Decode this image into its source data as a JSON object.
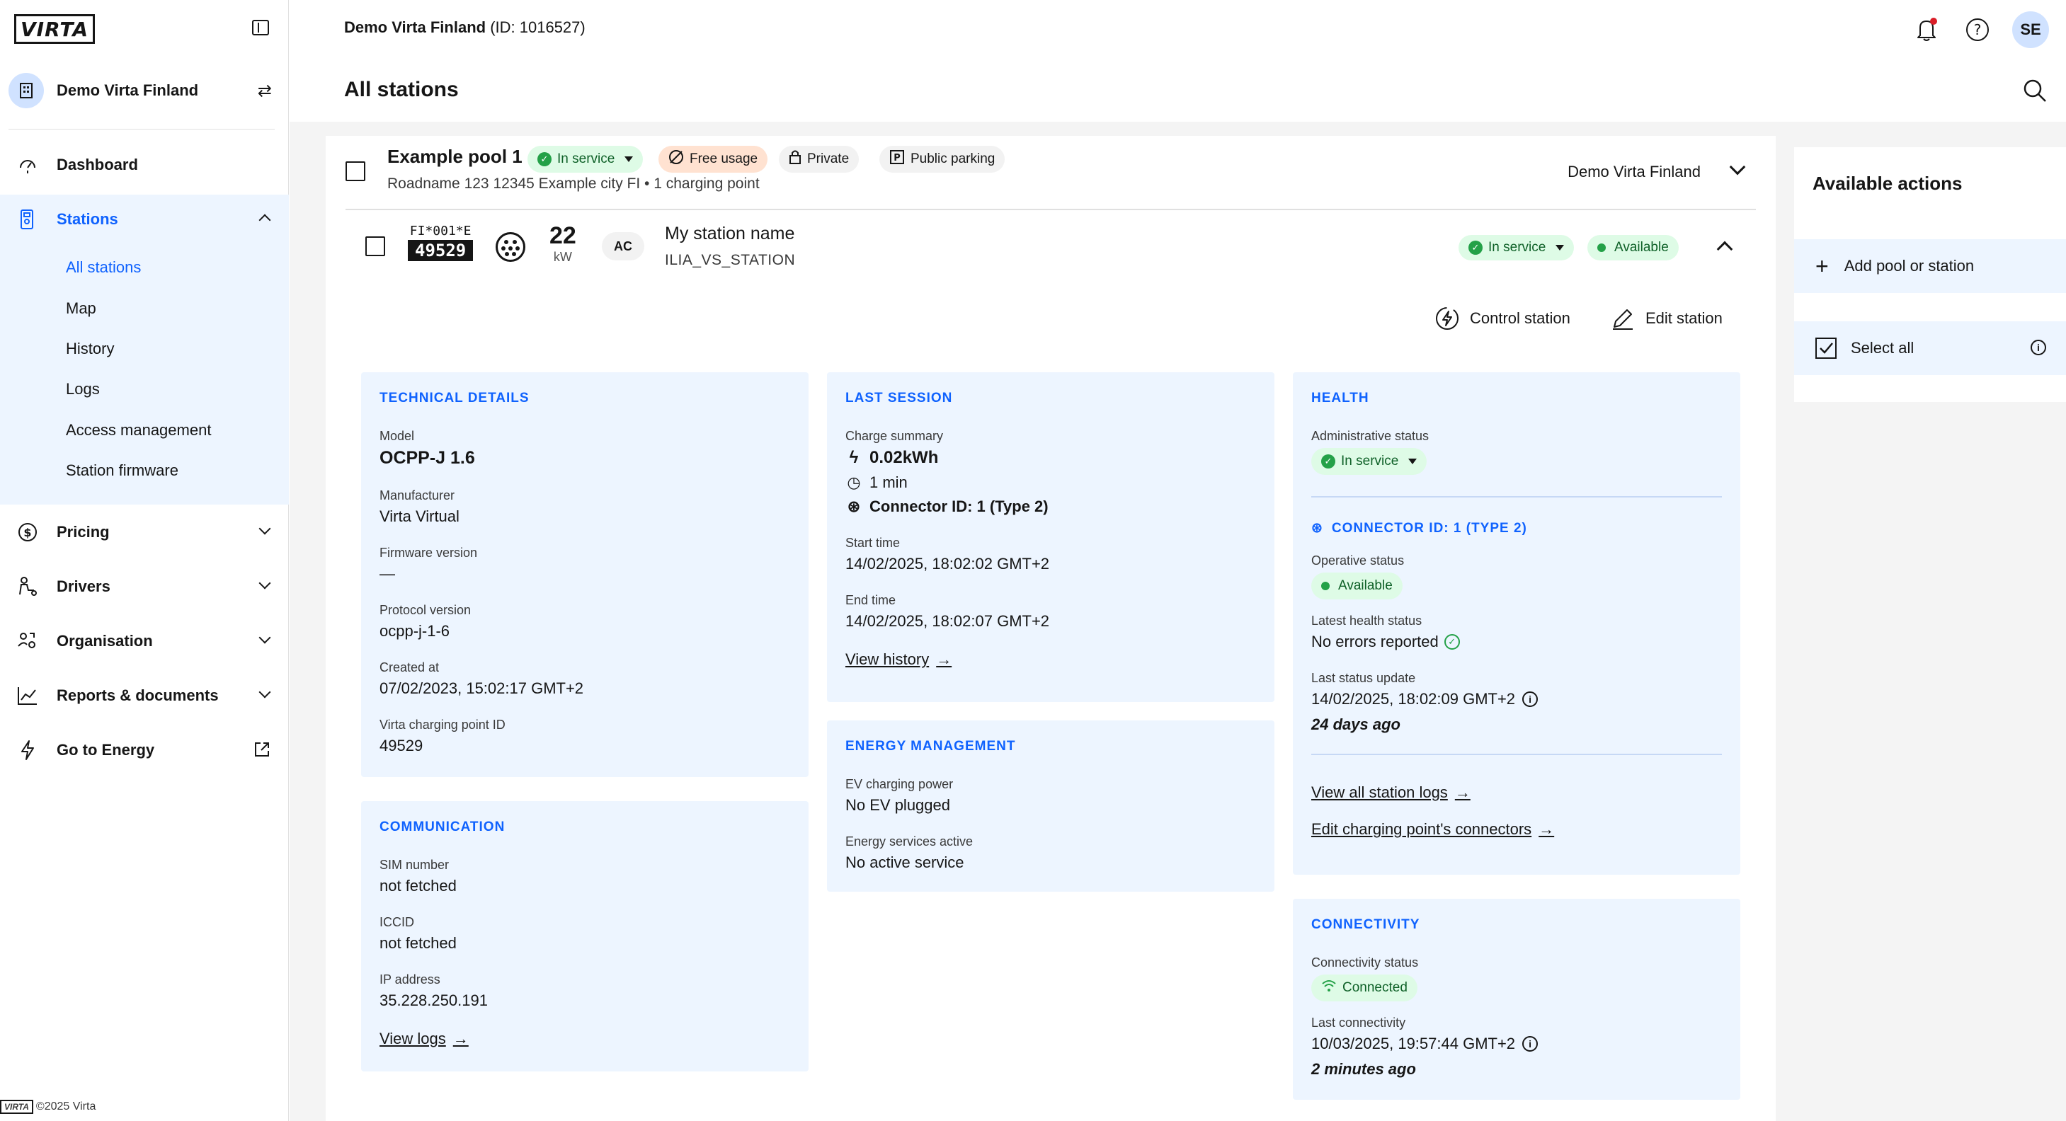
{
  "sidebar": {
    "logo": "VIRTA",
    "org_name": "Demo Virta Finland",
    "nav": {
      "dashboard": "Dashboard",
      "stations": "Stations",
      "pricing": "Pricing",
      "drivers": "Drivers",
      "organisation": "Organisation",
      "reports": "Reports & documents",
      "energy": "Go to Energy"
    },
    "station_sub": [
      "All stations",
      "Map",
      "History",
      "Logs",
      "Access management",
      "Station firmware"
    ],
    "footer_logo": "VIRTA",
    "footer": "©2025 Virta"
  },
  "header": {
    "org_bold": "Demo Virta Finland",
    "org_id": " (ID: 1016527)",
    "page_title": "All stations",
    "avatar": "SE"
  },
  "pool": {
    "name": "Example pool 1",
    "status": "In service",
    "tag_free": "Free usage",
    "tag_private": "Private",
    "tag_parking": "Public parking",
    "address": "Roadname 123 12345 Example city FI • 1 charging point",
    "org": "Demo Virta Finland"
  },
  "station": {
    "evse_code": "FI*001*E",
    "evse_num": "49529",
    "power": "22",
    "power_unit": "kW",
    "current_type": "AC",
    "name": "My station name",
    "id": "ILIA_VS_STATION",
    "status": "In service",
    "availability": "Available",
    "control": "Control station",
    "edit": "Edit station"
  },
  "technical": {
    "title": "TECHNICAL DETAILS",
    "model_label": "Model",
    "model": "OCPP-J 1.6",
    "manufacturer_label": "Manufacturer",
    "manufacturer": "Virta Virtual",
    "firmware_label": "Firmware version",
    "firmware": "—",
    "protocol_label": "Protocol version",
    "protocol": "ocpp-j-1-6",
    "created_label": "Created at",
    "created": "07/02/2023, 15:02:17 GMT+2",
    "cpid_label": "Virta charging point ID",
    "cpid": "49529"
  },
  "communication": {
    "title": "COMMUNICATION",
    "sim_label": "SIM number",
    "sim": "not fetched",
    "iccid_label": "ICCID",
    "iccid": "not fetched",
    "ip_label": "IP address",
    "ip": "35.228.250.191",
    "link": "View logs"
  },
  "last_session": {
    "title": "LAST SESSION",
    "summary_label": "Charge summary",
    "energy": "0.02kWh",
    "duration": "1 min",
    "connector": "Connector ID: 1 (Type 2)",
    "start_label": "Start time",
    "start": "14/02/2025, 18:02:02 GMT+2",
    "end_label": "End time",
    "end": "14/02/2025, 18:02:07 GMT+2",
    "link": "View history"
  },
  "energy_mgmt": {
    "title": "ENERGY MANAGEMENT",
    "ev_label": "EV charging power",
    "ev": "No EV plugged",
    "services_label": "Energy services active",
    "services": "No active service"
  },
  "health": {
    "title": "HEALTH",
    "admin_label": "Administrative status",
    "admin": "In service",
    "connector_title": "CONNECTOR ID: 1 (TYPE 2)",
    "operative_label": "Operative status",
    "operative": "Available",
    "latest_label": "Latest health status",
    "latest": "No errors reported",
    "update_label": "Last status update",
    "update": "14/02/2025, 18:02:09 GMT+2",
    "update_ago": "24 days ago",
    "link_logs": "View all station logs",
    "link_connectors": "Edit charging point's connectors"
  },
  "connectivity": {
    "title": "CONNECTIVITY",
    "status_label": "Connectivity status",
    "status": "Connected",
    "last_label": "Last connectivity",
    "last": "10/03/2025, 19:57:44 GMT+2",
    "last_ago": "2 minutes ago"
  },
  "actions": {
    "title": "Available actions",
    "add": "Add pool or station",
    "select_all": "Select all"
  },
  "colors": {
    "accent": "#0f62fe",
    "panel_bg": "#edf5ff",
    "success": "#24a148"
  }
}
